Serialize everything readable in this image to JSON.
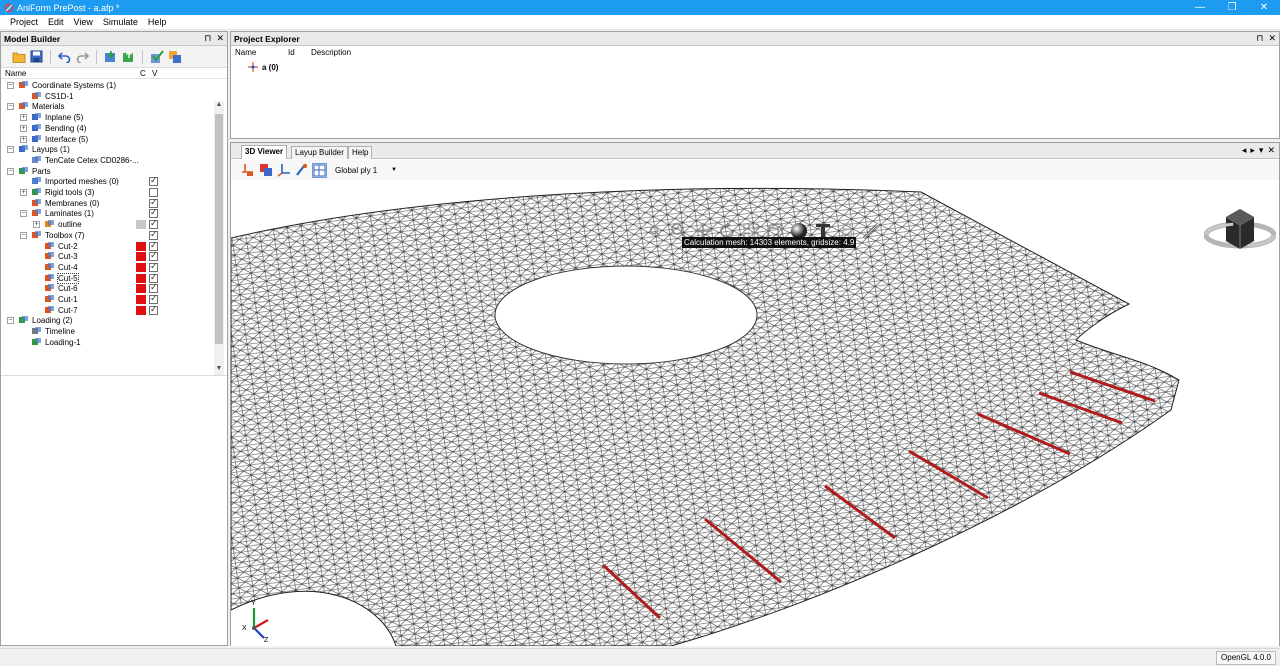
{
  "app": {
    "title": "AniForm PrePost - a.afp *",
    "window_buttons": [
      "—",
      "❐",
      "✕"
    ]
  },
  "menu": [
    "Project",
    "Edit",
    "View",
    "Simulate",
    "Help"
  ],
  "model_builder": {
    "title": "Model Builder",
    "header_buttons": [
      "⊓",
      "✕"
    ],
    "columns": {
      "name": "Name",
      "c": "C",
      "v": "V"
    },
    "tree": [
      {
        "label": "Coordinate Systems (1)",
        "icon": "coordinate-icon",
        "level": 0,
        "expander": "−"
      },
      {
        "label": "CS1D-1",
        "icon": "coordinate-icon",
        "level": 1
      },
      {
        "label": "Materials",
        "icon": "materials-icon",
        "level": 0,
        "expander": "−"
      },
      {
        "label": "Inplane (5)",
        "icon": "inplane-icon",
        "level": 1,
        "expander": "+"
      },
      {
        "label": "Bending (4)",
        "icon": "bending-icon",
        "level": 1,
        "expander": "+"
      },
      {
        "label": "Interface (5)",
        "icon": "interface-icon",
        "level": 1,
        "expander": "+"
      },
      {
        "label": "Layups (1)",
        "icon": "layups-icon",
        "level": 0,
        "expander": "−"
      },
      {
        "label": "TenCate Cetex CD0286-...",
        "icon": "layup-icon",
        "level": 1
      },
      {
        "label": "Parts",
        "icon": "parts-icon",
        "level": 0,
        "expander": "−"
      },
      {
        "label": "Imported meshes (0)",
        "icon": "mesh-icon",
        "level": 1,
        "v": true
      },
      {
        "label": "Rigid tools (3)",
        "icon": "rigid-tools-icon",
        "level": 1,
        "expander": "+",
        "v": false
      },
      {
        "label": "Membranes (0)",
        "icon": "membranes-icon",
        "level": 1,
        "v": true
      },
      {
        "label": "Laminates (1)",
        "icon": "laminates-icon",
        "level": 1,
        "expander": "−",
        "v": true
      },
      {
        "label": "outline",
        "icon": "laminate-icon",
        "level": 2,
        "expander": "+",
        "c": "#c8c8c8",
        "v": true
      },
      {
        "label": "Toolbox (7)",
        "icon": "toolbox-icon",
        "level": 1,
        "expander": "−",
        "v": true
      },
      {
        "label": "Cut-2",
        "icon": "cut-icon",
        "level": 2,
        "c": "#dd1111",
        "v": true
      },
      {
        "label": "Cut-3",
        "icon": "cut-icon",
        "level": 2,
        "c": "#dd1111",
        "v": true
      },
      {
        "label": "Cut-4",
        "icon": "cut-icon",
        "level": 2,
        "c": "#dd1111",
        "v": true
      },
      {
        "label": "Cut-5",
        "icon": "cut-icon",
        "level": 2,
        "c": "#dd1111",
        "v": true,
        "selected": true
      },
      {
        "label": "Cut-6",
        "icon": "cut-icon",
        "level": 2,
        "c": "#dd1111",
        "v": true
      },
      {
        "label": "Cut-1",
        "icon": "cut-icon",
        "level": 2,
        "c": "#dd1111",
        "v": true
      },
      {
        "label": "Cut-7",
        "icon": "cut-icon",
        "level": 2,
        "c": "#dd1111",
        "v": true
      },
      {
        "label": "Loading (2)",
        "icon": "loading-icon",
        "level": 0,
        "expander": "−"
      },
      {
        "label": "Timeline",
        "icon": "timeline-icon",
        "level": 1
      },
      {
        "label": "Loading-1",
        "icon": "loading-icon",
        "level": 1
      }
    ]
  },
  "project_explorer": {
    "title": "Project Explorer",
    "header_buttons": [
      "⊓",
      "✕"
    ],
    "columns": [
      "Name",
      "Id",
      "Description"
    ],
    "row_label": "a (0)"
  },
  "viewer": {
    "tabs": [
      "3D Viewer",
      "Layup Builder",
      "Help"
    ],
    "active_tab": "3D Viewer",
    "tab_controls": [
      "◂",
      "▸",
      "▾",
      "✕"
    ],
    "ply_select": "Global ply 1",
    "tooltip": "Calculation mesh: 14303 elements, gridsize: 4.9",
    "axes": {
      "y": "Y",
      "x": "X",
      "z": "Z"
    },
    "cut_color": "#b01c1c"
  },
  "statusbar": {
    "renderer": "OpenGL 4.0.0"
  }
}
